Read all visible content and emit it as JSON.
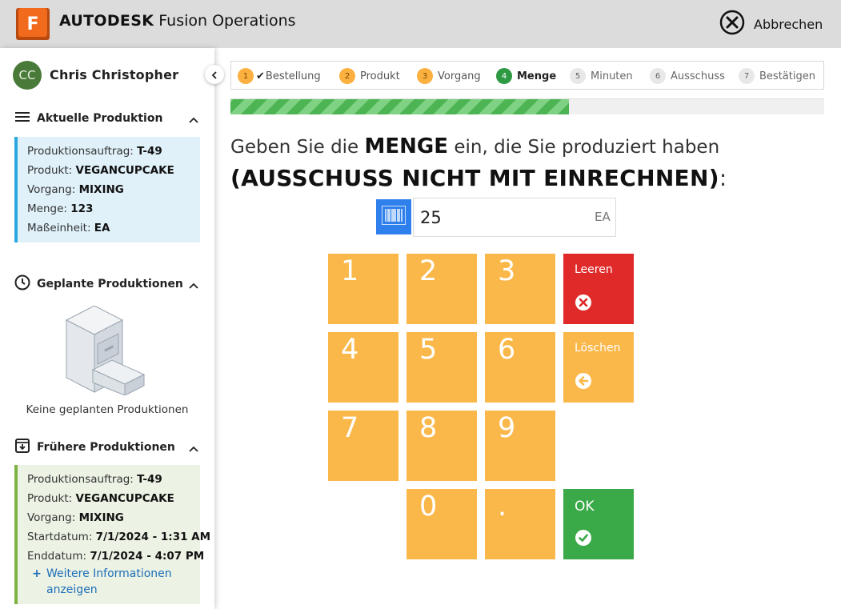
{
  "app": {
    "logo_letter": "F",
    "brand_bold": "AUTODESK",
    "brand_name": "Fusion Operations",
    "cancel_label": "Abbrechen"
  },
  "user": {
    "initials": "CC",
    "name": "Chris Christopher"
  },
  "sidebar": {
    "current": {
      "title": "Aktuelle Produktion",
      "lines": [
        {
          "label": "Produktionsauftrag: ",
          "value": "T-49"
        },
        {
          "label": "Produkt: ",
          "value": "VEGANCUPCAKE"
        },
        {
          "label": "Vorgang: ",
          "value": "MIXING"
        },
        {
          "label": "Menge: ",
          "value": "123"
        },
        {
          "label": "Maßeinheit: ",
          "value": "EA"
        }
      ]
    },
    "planned": {
      "title": "Geplante Produktionen",
      "empty_text": "Keine geplanten Produktionen"
    },
    "previous": {
      "title": "Frühere Produktionen",
      "lines": [
        {
          "label": "Produktionsauftrag: ",
          "value": "T-49"
        },
        {
          "label": "Produkt: ",
          "value": "VEGANCUPCAKE"
        },
        {
          "label": "Vorgang: ",
          "value": "MIXING"
        },
        {
          "label": "Startdatum: ",
          "value": "7/1/2024 - 1:31 AM"
        },
        {
          "label": "Enddatum: ",
          "value": "7/1/2024 - 4:07 PM"
        }
      ],
      "more_label": "Weitere Informationen anzeigen"
    }
  },
  "steps": [
    {
      "num": "1",
      "label": "Bestellung",
      "state": "done",
      "check": "✔"
    },
    {
      "num": "2",
      "label": "Produkt",
      "state": "done"
    },
    {
      "num": "3",
      "label": "Vorgang",
      "state": "done"
    },
    {
      "num": "4",
      "label": "Menge",
      "state": "active"
    },
    {
      "num": "5",
      "label": "Minuten",
      "state": "todo"
    },
    {
      "num": "6",
      "label": "Ausschuss",
      "state": "todo"
    },
    {
      "num": "7",
      "label": "Bestätigen",
      "state": "todo"
    }
  ],
  "progress": {
    "fraction": 0.57
  },
  "prompt": {
    "pre": "Geben Sie die ",
    "bold": "MENGE",
    "post": " ein, die Sie produziert haben",
    "line2": "(AUSSCHUSS NICHT MIT EINRECHNEN)",
    "colon": ":"
  },
  "quantity": {
    "value": "25",
    "unit": "EA"
  },
  "keypad": {
    "keys": [
      "1",
      "2",
      "3",
      "4",
      "5",
      "6",
      "7",
      "8",
      "9",
      "0",
      "."
    ],
    "clear_label": "Leeren",
    "delete_label": "Löschen",
    "ok_label": "OK"
  },
  "colors": {
    "accent_orange": "#fbb84a",
    "clear_red": "#e02a2a",
    "ok_green": "#3aa948",
    "active_step": "#2e9a44",
    "barcode_blue": "#2f80ed"
  }
}
